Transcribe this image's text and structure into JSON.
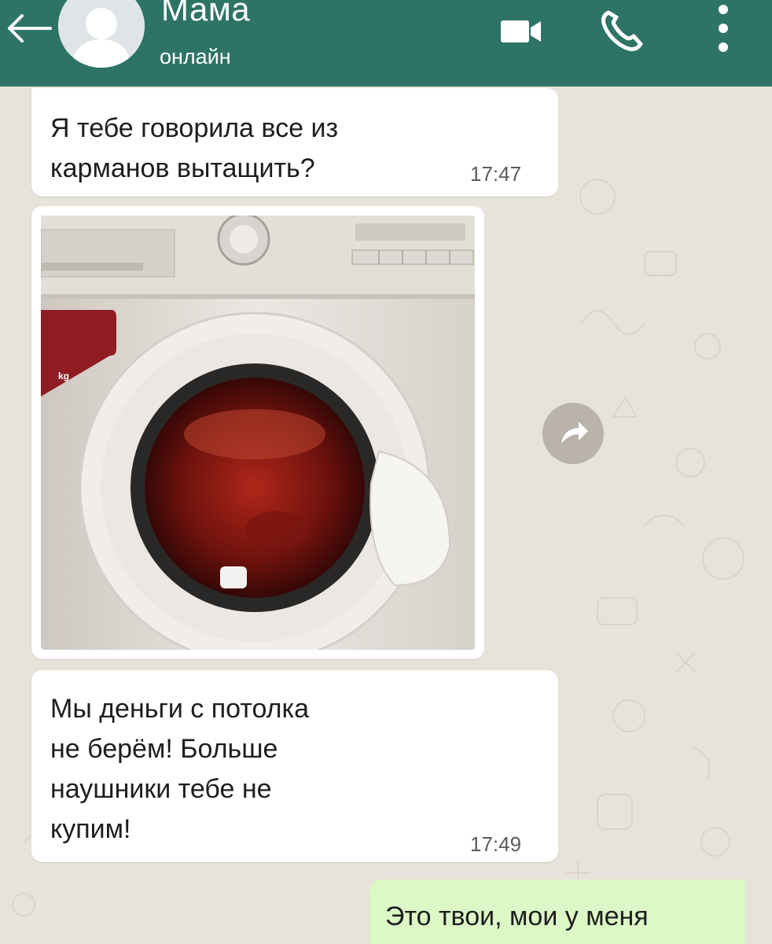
{
  "header": {
    "contact_name": "Мама",
    "status": "онлайн",
    "icons": {
      "back": "arrow-left-icon",
      "video": "video-camera-icon",
      "call": "phone-icon",
      "menu": "more-vertical-icon"
    }
  },
  "messages": [
    {
      "type": "text",
      "direction": "incoming",
      "text": "Я тебе говорила все из\nкарманов вытащить?",
      "time": "17:47"
    },
    {
      "type": "image",
      "direction": "incoming",
      "image_text": "kg"
    },
    {
      "type": "text",
      "direction": "incoming",
      "text": "Мы деньги с потолка\nне берём! Больше\nнаушники тебе не\nкупим!",
      "time": "17:49"
    },
    {
      "type": "text",
      "direction": "outgoing",
      "text": "Это твои, мои у меня"
    }
  ],
  "colors": {
    "header": "#2e7466",
    "incoming_bubble": "#ffffff",
    "outgoing_bubble": "#dcf8c6",
    "wallpaper": "#e8e3da"
  }
}
